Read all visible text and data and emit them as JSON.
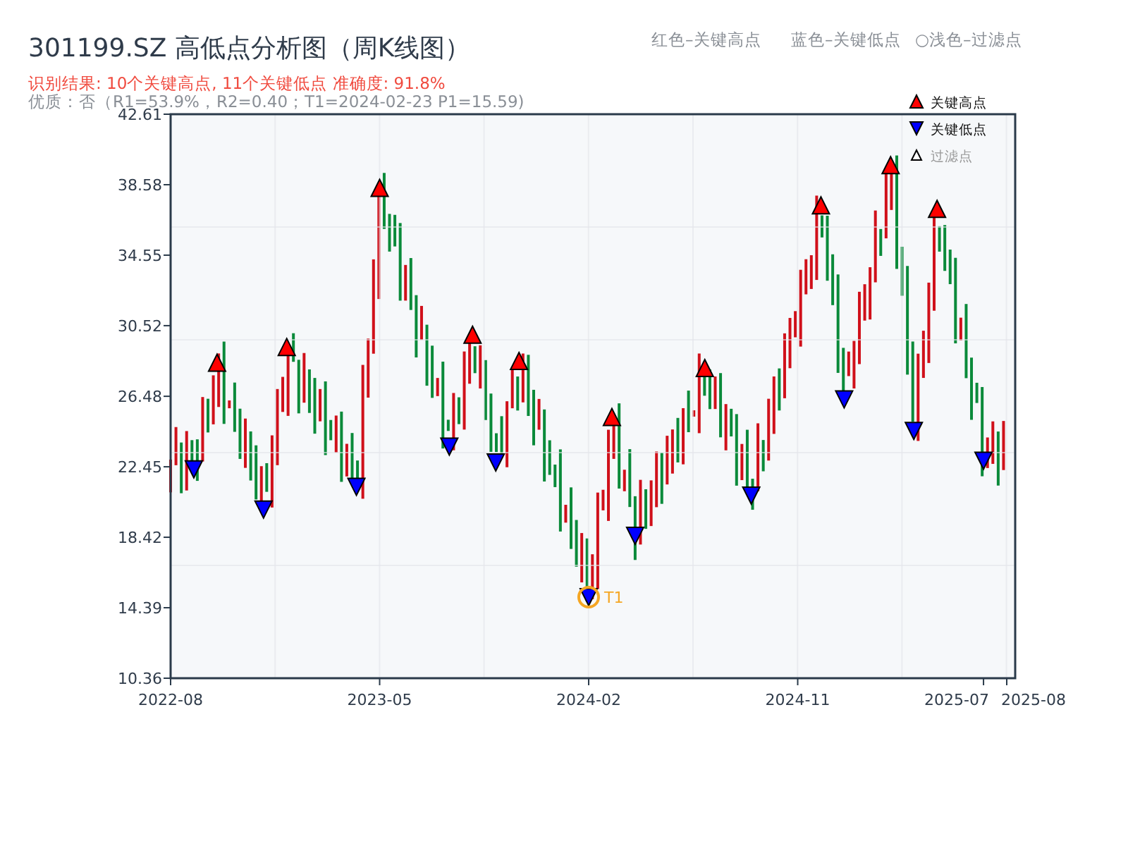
{
  "title": "301199.SZ 高低点分析图（周K线图）",
  "color_key": [
    "红色–关键高点",
    "蓝色–关键低点",
    "○浅色–过滤点"
  ],
  "summary": "识别结果: 10个关键高点, 11个关键低点  准确度: 91.8%",
  "quality": "优质：否（R1=53.9%，R2=0.40；T1=2024-02-23 P1=15.59)",
  "chart": {
    "filtered_legend": "过滤点",
    "chart_data": {
      "type": "scatter",
      "grid": true,
      "legend": "upper right",
      "ylim": [
        10.36,
        42.61
      ],
      "categories": [
        "2022-08",
        null,
        null,
        null,
        null,
        null,
        null,
        null,
        null,
        "2023-05",
        null,
        null,
        null,
        null,
        null,
        null,
        null,
        null,
        "2024-02",
        null,
        null,
        null,
        null,
        null,
        null,
        null,
        null,
        "2024-11",
        null,
        null,
        null,
        null,
        null,
        null,
        null,
        "2025-07",
        "2025-08"
      ],
      "yticks": [
        10.36,
        14.39,
        18.42,
        22.45,
        26.48,
        30.52,
        34.55,
        38.58,
        42.61
      ],
      "series": [
        {
          "name": "关键高点",
          "color": "#ff0000",
          "values": [
            null,
            null,
            28.4,
            null,
            null,
            29.3,
            null,
            null,
            null,
            38.4,
            null,
            null,
            null,
            30.0,
            null,
            28.5,
            null,
            null,
            null,
            25.3,
            null,
            null,
            null,
            28.1,
            null,
            null,
            null,
            null,
            37.4,
            null,
            null,
            39.7,
            null,
            37.2,
            null,
            null,
            null
          ]
        },
        {
          "name": "关键低点",
          "color": "#0000ff",
          "values": [
            null,
            22.3,
            null,
            null,
            20.0,
            null,
            null,
            null,
            21.3,
            null,
            null,
            null,
            23.6,
            null,
            22.7,
            null,
            null,
            null,
            15.0,
            null,
            18.5,
            null,
            null,
            null,
            null,
            20.8,
            null,
            null,
            null,
            26.3,
            null,
            null,
            24.5,
            null,
            null,
            22.8,
            null
          ]
        }
      ],
      "annotations": [
        "T1"
      ]
    }
  }
}
